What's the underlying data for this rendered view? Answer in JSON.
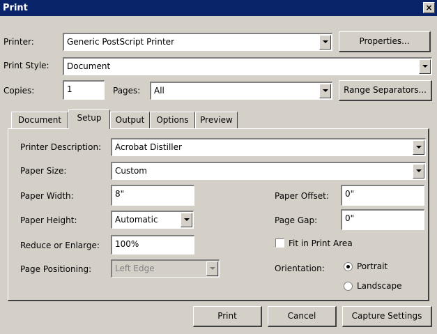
{
  "window": {
    "title": "Print",
    "close_glyph": "×"
  },
  "printer": {
    "label": "Printer:",
    "value": "Generic PostScript Printer",
    "properties_button": "Properties..."
  },
  "print_style": {
    "label": "Print Style:",
    "value": "Document"
  },
  "copies": {
    "label": "Copies:",
    "value": "1"
  },
  "pages": {
    "label": "Pages:",
    "value": "All",
    "range_button": "Range Separators..."
  },
  "tabs": [
    {
      "label": "Document",
      "active": false
    },
    {
      "label": "Setup",
      "active": true
    },
    {
      "label": "Output",
      "active": false
    },
    {
      "label": "Options",
      "active": false
    },
    {
      "label": "Preview",
      "active": false
    }
  ],
  "setup": {
    "printer_description": {
      "label": "Printer Description:",
      "value": "Acrobat Distiller"
    },
    "paper_size": {
      "label": "Paper Size:",
      "value": "Custom"
    },
    "paper_width": {
      "label": "Paper Width:",
      "value": "8\""
    },
    "paper_height": {
      "label": "Paper Height:",
      "value": "Automatic"
    },
    "reduce_enlarge": {
      "label": "Reduce or Enlarge:",
      "value": "100%"
    },
    "page_positioning": {
      "label": "Page Positioning:",
      "value": "Left Edge"
    },
    "paper_offset": {
      "label": "Paper Offset:",
      "value": "0\""
    },
    "page_gap": {
      "label": "Page Gap:",
      "value": "0\""
    },
    "fit_in_print_area": {
      "label": "Fit in Print Area",
      "checked": false
    },
    "orientation": {
      "label": "Orientation:",
      "options": [
        {
          "label": "Portrait",
          "selected": true
        },
        {
          "label": "Landscape",
          "selected": false
        }
      ]
    }
  },
  "footer": {
    "print_button": "Print",
    "cancel_button": "Cancel",
    "capture_button": "Capture Settings"
  }
}
